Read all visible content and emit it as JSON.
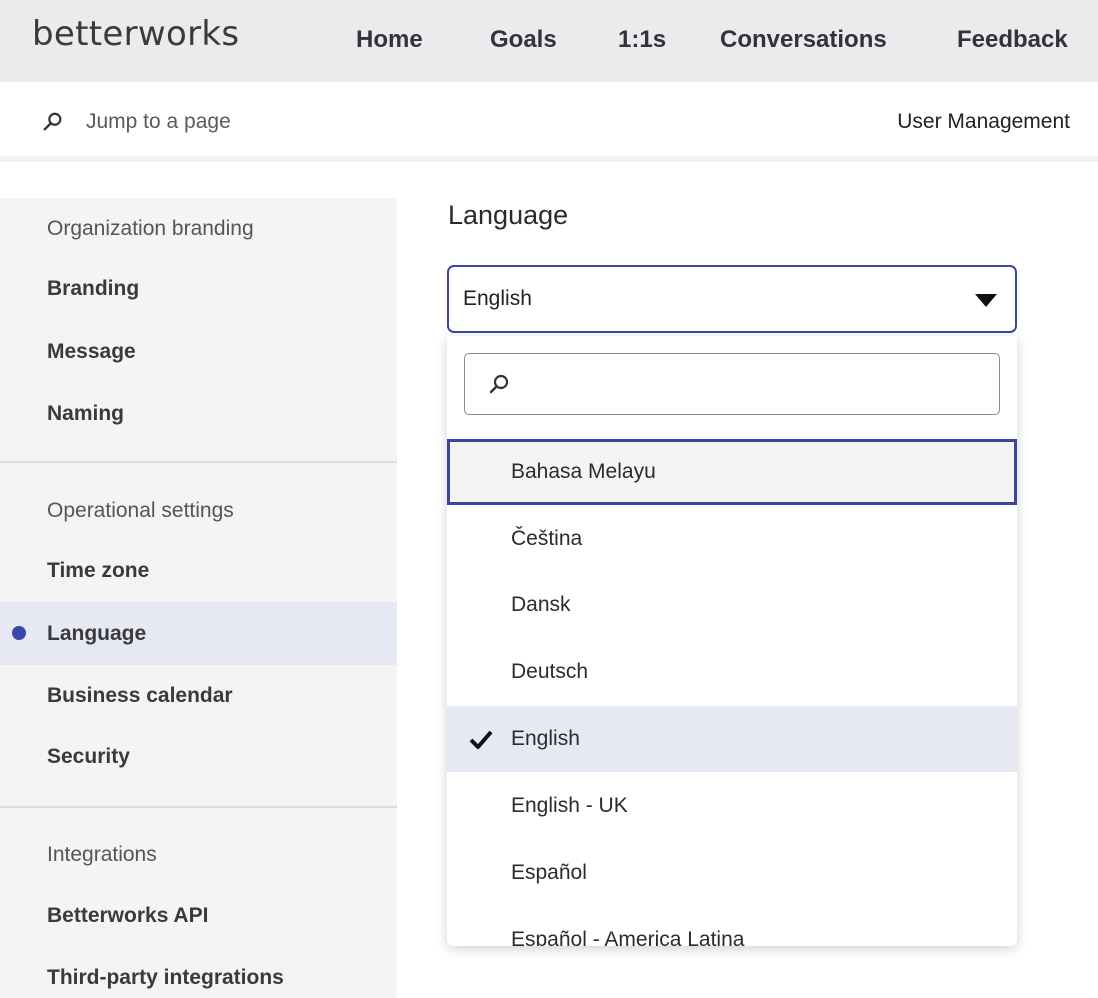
{
  "header": {
    "logo": "betterworks",
    "nav": [
      {
        "label": "Home"
      },
      {
        "label": "Goals"
      },
      {
        "label": "1:1s"
      },
      {
        "label": "Conversations"
      },
      {
        "label": "Feedback"
      }
    ]
  },
  "subbar": {
    "jump_placeholder": "Jump to a page",
    "user_management": "User Management"
  },
  "sidebar": {
    "sections": [
      {
        "header": "Organization branding",
        "items": [
          "Branding",
          "Message",
          "Naming"
        ]
      },
      {
        "header": "Operational settings",
        "items": [
          "Time zone",
          "Language",
          "Business calendar",
          "Security"
        ]
      },
      {
        "header": "Integrations",
        "items": [
          "Betterworks API",
          "Third-party integrations"
        ]
      }
    ],
    "active_item": "Language"
  },
  "main": {
    "title": "Language",
    "select": {
      "value": "English",
      "search_placeholder": "",
      "options": [
        {
          "label": "Bahasa Melayu",
          "state": "focused"
        },
        {
          "label": "Čeština",
          "state": ""
        },
        {
          "label": "Dansk",
          "state": ""
        },
        {
          "label": "Deutsch",
          "state": ""
        },
        {
          "label": "English",
          "state": "selected"
        },
        {
          "label": "English - UK",
          "state": ""
        },
        {
          "label": "Español",
          "state": ""
        },
        {
          "label": "Español - America Latina",
          "state": ""
        }
      ]
    }
  },
  "colors": {
    "accent": "#3a47a8",
    "topbar_bg": "#ebebee",
    "sidebar_bg": "#f4f4f6",
    "active_bg": "#e6e8f3"
  },
  "icons": {
    "search": "search-icon",
    "caret": "caret-down-icon",
    "check": "check-icon"
  }
}
